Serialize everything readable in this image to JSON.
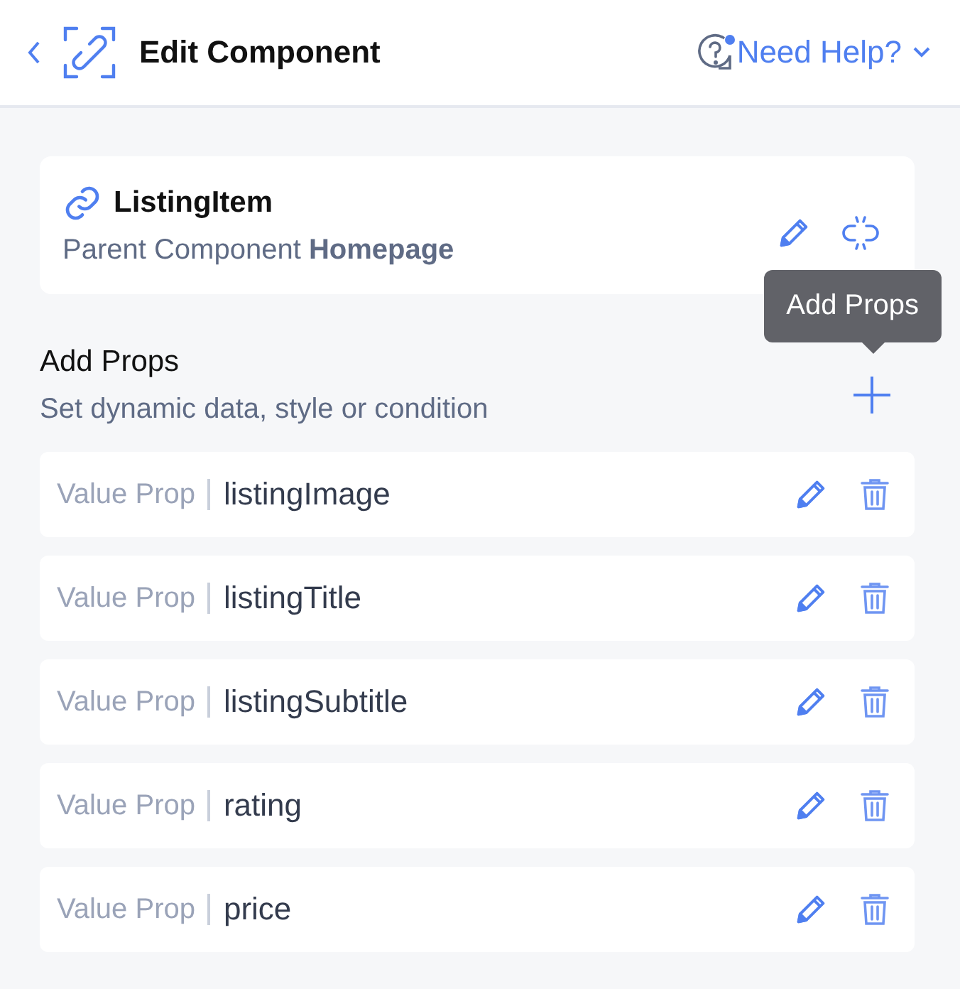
{
  "header": {
    "title": "Edit Component",
    "help_label": "Need Help?"
  },
  "component": {
    "name": "ListingItem",
    "parent": "Parent Component **Homepage**"
  },
  "props_section": {
    "title": "Add Props",
    "subtitle": "Set dynamic data, style or condition",
    "tooltip": "Add Props"
  },
  "props": [
    {
      "kind": "value",
      "type_label": "Value Prop",
      "name": "listingImage"
    },
    {
      "kind": "value",
      "type_label": "Value Prop",
      "name": "listingTitle"
    },
    {
      "kind": "value",
      "type_label": "Value Prop",
      "name": "listingSubtitle"
    },
    {
      "kind": "value",
      "type_label": "Value Prop",
      "name": "rating"
    },
    {
      "kind": "value",
      "type_label": "Value Prop",
      "name": "price"
    }
  ]
}
